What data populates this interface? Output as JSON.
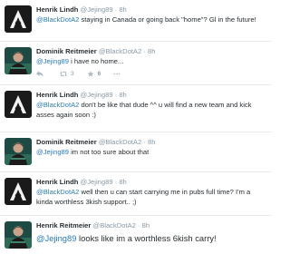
{
  "tweets": [
    {
      "name": "Henrik Lindh",
      "handle": "@Jejing89",
      "time": "8h",
      "mention": "@BlackDotA2",
      "text": " staying in Canada or going back \"home\"? Gl in the future!",
      "avatar": "a-logo-avatar"
    },
    {
      "name": "Dominik Reitmeier",
      "handle": "@BlackDotA2",
      "time": "8h",
      "mention": "@Jejing89",
      "text": " i have no home...",
      "avatar": "player-photo-avatar",
      "retweets": "3",
      "favorites": "6"
    },
    {
      "name": "Henrik Lindh",
      "handle": "@Jejing89",
      "time": "8h",
      "mention": "@BlackDotA2",
      "text": " don't be like that dude ^^ u will find a new team and kick asses again soon :)",
      "avatar": "a-logo-avatar"
    },
    {
      "name": "Dominik Reitmeier",
      "handle": "@BlackDotA2",
      "time": "8h",
      "mention": "@Jejing89",
      "text": " im not too sure about that",
      "avatar": "player-photo-avatar"
    },
    {
      "name": "Henrik Lindh",
      "handle": "@Jejing89",
      "time": "8h",
      "mention": "@BlackDotA2",
      "text": " well then u can start carrying me in pubs full time? I'm a kinda worthless 3kish support.. ;)",
      "avatar": "a-logo-avatar"
    },
    {
      "name": "Henrik Reitmeier",
      "handle": "@BlackDotA2",
      "time": "8h",
      "mention": "@Jejing89",
      "text": " looks like im a worthless 6kish carry!",
      "avatar": "player-photo-avatar"
    }
  ],
  "separator": "·",
  "colors": {
    "link": "#2b7bb9",
    "muted": "#8899a6",
    "text": "#292f33"
  }
}
